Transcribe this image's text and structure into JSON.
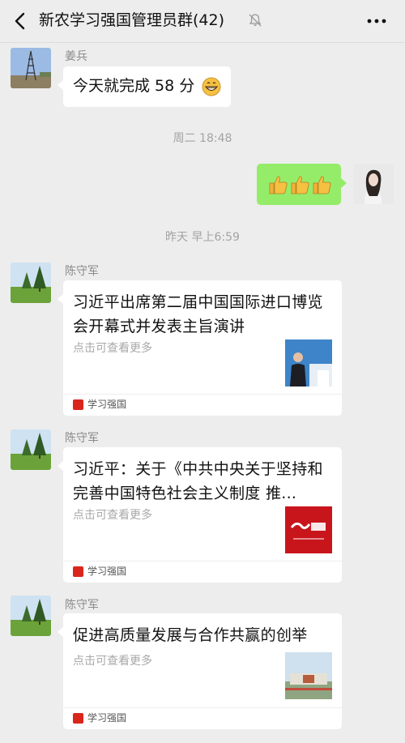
{
  "header": {
    "title": "新农学习强国管理员群(42)",
    "back_icon": "chevron-left-icon",
    "mute_icon": "bell-muted-icon",
    "more_icon": "ellipsis-icon"
  },
  "messages": [
    {
      "sender": "姜兵",
      "text": "今天就完成 58 分",
      "emoji": "grinning-face-icon"
    },
    {
      "timestamp": "周二 18:48"
    },
    {
      "mine": true,
      "emoji": [
        "thumbs-up-icon",
        "thumbs-up-icon",
        "thumbs-up-icon"
      ]
    },
    {
      "timestamp": "昨天 早上6:59"
    },
    {
      "sender": "陈守军",
      "card": {
        "title": "习近平出席第二届中国国际进口博览会开幕式并发表主旨演讲",
        "desc": "点击可查看更多",
        "source": "学习强国"
      }
    },
    {
      "sender": "陈守军",
      "card": {
        "title": "习近平：关于《中共中央关于坚持和完善中国特色社会主义制度 推...",
        "desc": "点击可查看更多",
        "source": "学习强国"
      }
    },
    {
      "sender": "陈守军",
      "card": {
        "title": "促进高质量发展与合作共赢的创举",
        "desc": "点击可查看更多",
        "source": "学习强国"
      }
    }
  ],
  "colors": {
    "background": "#ededed",
    "my_bubble": "#95ec69",
    "source_brand": "#d9261c"
  }
}
